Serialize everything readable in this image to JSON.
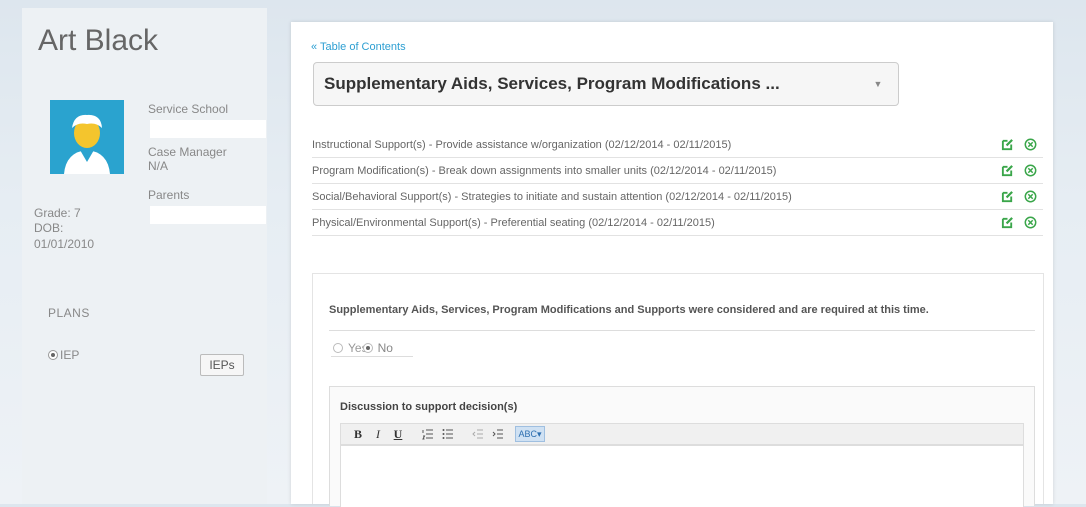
{
  "student": {
    "name": "Art Black",
    "service_school_label": "Service School",
    "case_manager_label": "Case Manager",
    "case_manager_value": "N/A",
    "parents_label": "Parents",
    "grade": "Grade: 7",
    "dob_label": "DOB:",
    "dob_value": "01/01/2010"
  },
  "plans": {
    "label": "PLANS",
    "radio_label": "IEP",
    "ieps_button": "IEPs"
  },
  "main": {
    "toc_link": "« Table of Contents",
    "section_title": "Supplementary Aids, Services, Program Modifications ...",
    "caret": "▼",
    "supports": [
      "Instructional Support(s) - Provide assistance w/organization (02/12/2014 - 02/11/2015)",
      "Program Modification(s) - Break down assignments into smaller units (02/12/2014 - 02/11/2015)",
      "Social/Behavioral Support(s) - Strategies to initiate and sustain attention (02/12/2014 - 02/11/2015)",
      "Physical/Environmental Support(s) - Preferential seating (02/12/2014 - 02/11/2015)"
    ],
    "question": "Supplementary Aids, Services, Program Modifications and Supports were considered and are required at this time.",
    "yes_label": "Yes",
    "no_label": "No",
    "selected": "No",
    "discussion_label": "Discussion to support decision(s)",
    "toolbar": {
      "bold": "B",
      "italic": "I",
      "underline": "U",
      "spell": "ABC▾"
    }
  },
  "colors": {
    "accent": "#2d9fd2",
    "icon_green": "#3aa64a",
    "avatar_bg": "#2aa3cf"
  },
  "icons": [
    "edit-icon",
    "remove-icon",
    "ordered-list-icon",
    "bullet-list-icon",
    "outdent-icon",
    "indent-icon",
    "spellcheck-icon"
  ]
}
